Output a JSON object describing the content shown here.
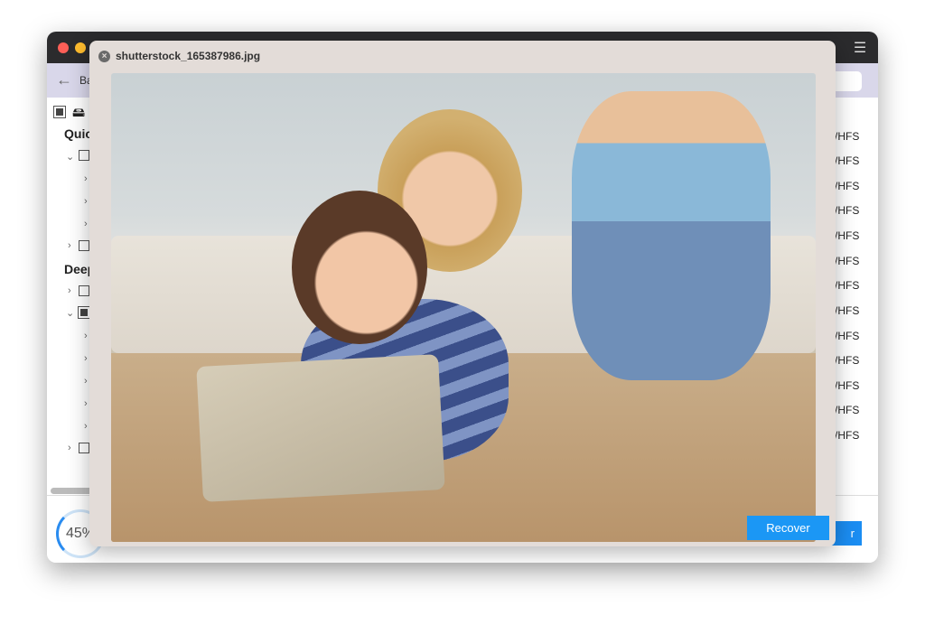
{
  "app": {
    "back_label": "Ba",
    "sections": [
      "Quic",
      "Deep"
    ],
    "fs_column": [
      "/HFS",
      "/HFS",
      "/HFS",
      "/HFS",
      "/HFS",
      "/HFS",
      "/HFS",
      "/HFS",
      "/HFS",
      "/HFS",
      "/HFS",
      "/HFS",
      "/HFS"
    ],
    "progress_percent": "45%",
    "stop_button_partial": "r"
  },
  "preview": {
    "filename": "shutterstock_165387986.jpg",
    "recover_label": "Recover"
  },
  "colors": {
    "accent": "#1b97f5",
    "titlebar": "#2b2b2d",
    "toolbar": "#d9d7ea",
    "modal": "#e3dcd8"
  }
}
